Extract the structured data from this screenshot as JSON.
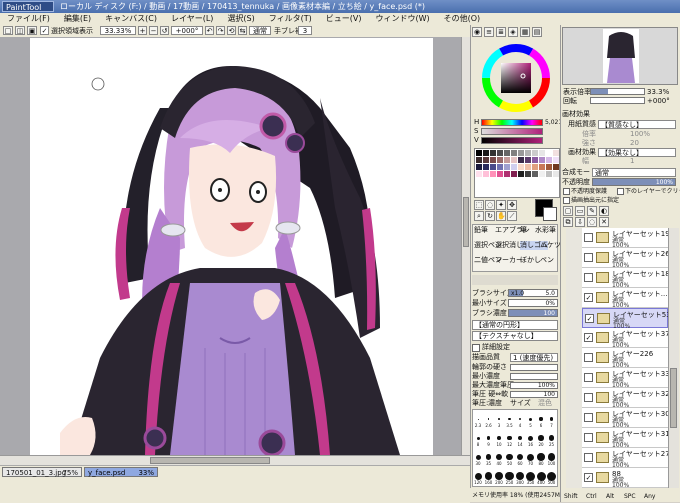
{
  "app": {
    "logo": "PaintTool SAI",
    "window_title": "ローカル ディスク (F:) / 動画 / 17動画 / 170413_tennuka / 画像素材本編 / 立ち絵 / y_face.psd (*)"
  },
  "menu": [
    "ファイル(F)",
    "編集(E)",
    "キャンバス(C)",
    "レイヤー(L)",
    "選択(S)",
    "フィルタ(T)",
    "ビュー(V)",
    "ウィンドウ(W)",
    "その他(O)"
  ],
  "toolbar": {
    "show_selection": "選択領域表示",
    "zoom": "33.33%",
    "angle": "+000°",
    "blend": "通常",
    "stabilizer_label": "手ブレ補正",
    "stabilizer_value": "3"
  },
  "color": {
    "h_label": "H",
    "s_label": "S",
    "v_label": "V",
    "value": "5,021"
  },
  "navigator": {
    "zoom_label": "表示倍率",
    "zoom_value": "33.3%",
    "angle_label": "回転",
    "angle_value": "+000°"
  },
  "texture": {
    "title": "画材効果",
    "paper_label": "用紙質感",
    "paper_value": "【質感なし】",
    "scale_label": "倍率",
    "scale_value": "100%",
    "strength_label": "強さ",
    "strength_value": "20",
    "effect_label": "画材効果",
    "effect_value": "【効果なし】",
    "width_label": "幅",
    "width_value": "1",
    "strength2_label": "強さ",
    "strength2_value": "100"
  },
  "layer_opts": {
    "blend_label": "合成モード",
    "blend_value": "通常",
    "opacity_label": "不透明度",
    "opacity_value": "100%",
    "protect_label": "不透明度保護",
    "clip_label": "下のレイヤーでクリッピング",
    "sel_src_label": "描画抽出元に指定"
  },
  "layers": [
    {
      "name": "レイヤーセット19",
      "mode": "通常",
      "opacity": "100%",
      "selected": false,
      "visible": false
    },
    {
      "name": "レイヤーセット26",
      "mode": "通常",
      "opacity": "100%",
      "selected": false,
      "visible": false
    },
    {
      "name": "レイヤーセット18",
      "mode": "通常",
      "opacity": "100%",
      "selected": false,
      "visible": false
    },
    {
      "name": "レイヤーセット...",
      "mode": "通常",
      "opacity": "100%",
      "selected": false,
      "visible": true
    },
    {
      "name": "レイヤーセット53",
      "mode": "通常",
      "opacity": "100%",
      "selected": true,
      "visible": true
    },
    {
      "name": "レイヤーセット37",
      "mode": "通常",
      "opacity": "100%",
      "selected": false,
      "visible": true
    },
    {
      "name": "レイヤー226",
      "mode": "通常",
      "opacity": "100%",
      "selected": false,
      "visible": false
    },
    {
      "name": "レイヤーセット33",
      "mode": "通常",
      "opacity": "100%",
      "selected": false,
      "visible": false
    },
    {
      "name": "レイヤーセット32",
      "mode": "通常",
      "opacity": "100%",
      "selected": false,
      "visible": false
    },
    {
      "name": "レイヤーセット30",
      "mode": "通常",
      "opacity": "100%",
      "selected": false,
      "visible": false
    },
    {
      "name": "レイヤーセット31",
      "mode": "通常",
      "opacity": "100%",
      "selected": false,
      "visible": false
    },
    {
      "name": "レイヤーセット27",
      "mode": "通常",
      "opacity": "100%",
      "selected": false,
      "visible": false
    },
    {
      "name": "88",
      "mode": "通常",
      "opacity": "100%",
      "selected": false,
      "visible": true
    }
  ],
  "tools": {
    "brush_names": [
      "鉛筆",
      "エアブラシ",
      "筆",
      "水彩筆",
      "選択ペン",
      "選択消し",
      "消しゴム",
      "バケツ",
      "二値ペン",
      "マーカー",
      "ぼかし",
      "ペン"
    ],
    "brush_size_label": "ブラシサイズ",
    "brush_size_mult": "x1.0",
    "brush_size_value": "5.0",
    "min_size_label": "最小サイズ",
    "min_size_value": "0%",
    "density_label": "ブラシ濃度",
    "density_value": "100",
    "shape_value": "【通常の円形】",
    "texture_value": "【テクスチャなし】",
    "detail_label": "詳細設定",
    "quality_label": "描画品質",
    "quality_value": "1 (速度優先)",
    "edge_label": "輪郭の硬さ",
    "min_density_label": "最小濃度",
    "max_density_label": "最大濃度筆圧",
    "max_density_value": "100%",
    "pressure_label": "筆圧 硬⇔軟",
    "pressure_value": "100",
    "pressure2_label": "筆圧:",
    "density_chk": "濃度",
    "size_chk": "サイズ",
    "blend_chk": "混色",
    "size_presets": [
      "2.3",
      "2.6",
      "3",
      "3.5",
      "4",
      "5",
      "6",
      "7",
      "8",
      "9",
      "10",
      "12",
      "14",
      "16",
      "20",
      "25",
      "30",
      "35",
      "40",
      "50",
      "60",
      "70",
      "80",
      "100",
      "120",
      "160",
      "200",
      "250",
      "300",
      "350",
      "400",
      "500"
    ]
  },
  "statusbar": {
    "memory": "メモリ使用率 18% (使用2457MB/上限4095MB)",
    "shift": "Shift",
    "ctrl": "Ctrl",
    "alt": "Alt",
    "space": "SPC",
    "any": "Any"
  },
  "doc_tabs": [
    {
      "name": "170501_01_3.jpg",
      "zoom": "75%"
    },
    {
      "name": "y_face.psd",
      "zoom": "33%"
    }
  ],
  "palette_colors": [
    "#000000",
    "#1a1a1a",
    "#333333",
    "#4d4d4d",
    "#666666",
    "#808080",
    "#999999",
    "#b3b3b3",
    "#cccccc",
    "#e6e6e6",
    "#ffffff",
    "#f2e0e0",
    "#3a2a2a",
    "#5a3a3a",
    "#7a4a4a",
    "#9a6a6a",
    "#c49a9a",
    "#e6c4c4",
    "#3a2a4a",
    "#5a3a6a",
    "#8a5aa0",
    "#b08ac8",
    "#d4b8e6",
    "#f0e0f8",
    "#1a1a3a",
    "#2a2a5a",
    "#4a4a8a",
    "#7070b0",
    "#a0a0d0",
    "#d0d0f0",
    "#f8d8c8",
    "#f0c0a8",
    "#e0a080",
    "#c87858",
    "#a05838",
    "#703820",
    "#ffe0ec",
    "#ffc0d8",
    "#ff90b8",
    "#e05090",
    "#b03070",
    "#802050",
    "#202020",
    "#404040",
    "#606060",
    "#f0f0f0",
    "#c0c0c0",
    "#e8e8e8"
  ]
}
